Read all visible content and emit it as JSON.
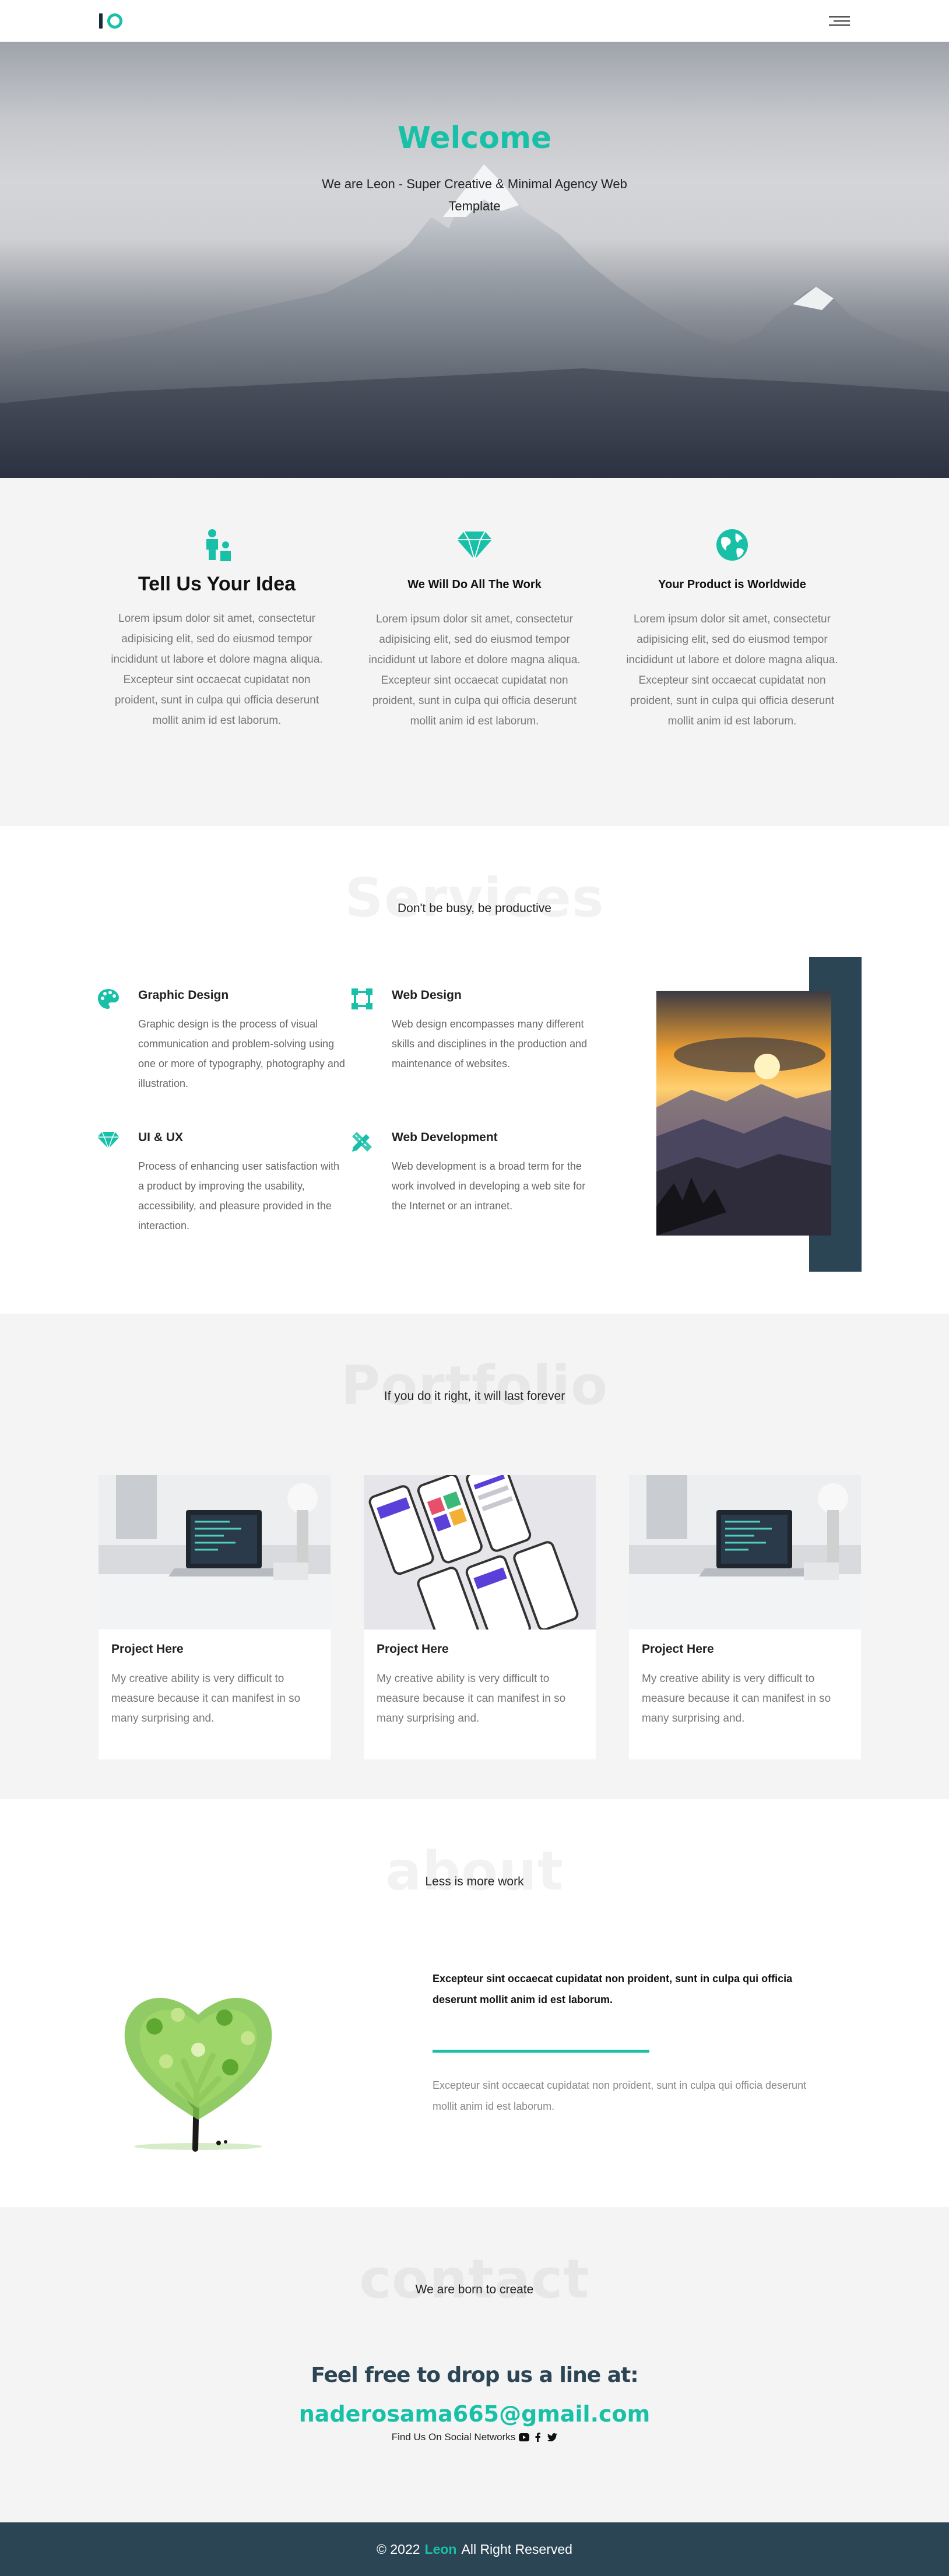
{
  "brand": {
    "accent": "#19c0a8",
    "dark": "#2c4555"
  },
  "header": {
    "logo_icon": "io-logo",
    "menu_icon": "hamburger-icon"
  },
  "hero": {
    "title": "Welcome",
    "subtitle": "We are Leon - Super Creative & Minimal Agency Web Template"
  },
  "features": [
    {
      "icon": "family-icon",
      "title": "Tell Us Your Idea",
      "text": "Lorem ipsum dolor sit amet, consectetur adipisicing elit, sed do eiusmod tempor incididunt ut labore et dolore magna aliqua. Excepteur sint occaecat cupidatat non proident, sunt in culpa qui officia deserunt mollit anim id est laborum."
    },
    {
      "icon": "diamond-icon",
      "title": "We Will Do All The Work",
      "text": "Lorem ipsum dolor sit amet, consectetur adipisicing elit, sed do eiusmod tempor incididunt ut labore et dolore magna aliqua. Excepteur sint occaecat cupidatat non proident, sunt in culpa qui officia deserunt mollit anim id est laborum."
    },
    {
      "icon": "globe-icon",
      "title": "Your Product is Worldwide",
      "text": "Lorem ipsum dolor sit amet, consectetur adipisicing elit, sed do eiusmod tempor incididunt ut labore et dolore magna aliqua. Excepteur sint occaecat cupidatat non proident, sunt in culpa qui officia deserunt mollit anim id est laborum."
    }
  ],
  "services": {
    "watermark": "Services",
    "subtitle": "Don't be busy, be productive",
    "items": [
      {
        "icon": "palette-icon",
        "title": "Graphic Design",
        "text": "Graphic design is the process of visual communication and problem-solving using one or more of typography, photography and illustration."
      },
      {
        "icon": "vector-square-icon",
        "title": "Web Design",
        "text": "Web design encompasses many different skills and disciplines in the production and maintenance of websites."
      },
      {
        "icon": "gem-icon",
        "title": "UI & UX",
        "text": "Process of enhancing user satisfaction with a product by improving the usability, accessibility, and pleasure provided in the interaction."
      },
      {
        "icon": "pencil-ruler-icon",
        "title": "Web Development",
        "text": "Web development is a broad term for the work involved in developing a web site for the Internet or an intranet."
      }
    ]
  },
  "portfolio": {
    "watermark": "Portfolio",
    "subtitle": "If you do it right, it will last forever",
    "cards": [
      {
        "title": "Project Here",
        "text": "My creative ability is very difficult to measure because it can manifest in so many surprising and."
      },
      {
        "title": "Project Here",
        "text": "My creative ability is very difficult to measure because it can manifest in so many surprising and."
      },
      {
        "title": "Project Here",
        "text": "My creative ability is very difficult to measure because it can manifest in so many surprising and."
      }
    ]
  },
  "about": {
    "watermark": "about",
    "subtitle": "Less is more work",
    "bold_text": "Excepteur sint occaecat cupidatat non proident, sunt in culpa qui officia deserunt mollit anim id est laborum.",
    "light_text": "Excepteur sint occaecat cupidatat non proident, sunt in culpa qui officia deserunt mollit anim id est laborum."
  },
  "contact": {
    "watermark": "contact",
    "subtitle": "We are born to create",
    "headline": "Feel free to drop us a line at:",
    "email": "naderosama665@gmail.com",
    "social_label": "Find Us On Social Networks",
    "social_icons": [
      "youtube-icon",
      "facebook-icon",
      "twitter-icon"
    ]
  },
  "footer": {
    "prefix": "© 2022",
    "brand": "Leon",
    "suffix": "All Right Reserved"
  }
}
